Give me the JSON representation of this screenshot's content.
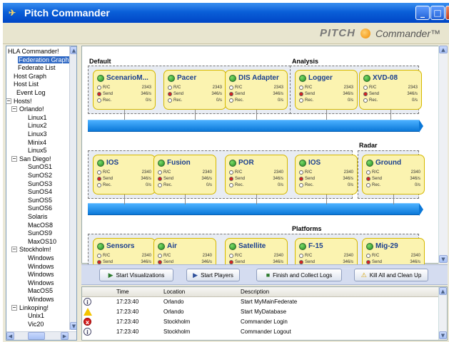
{
  "window": {
    "title": "Pitch Commander"
  },
  "brand": {
    "pitch": "PITCH",
    "product": "Commander™"
  },
  "tree": [
    {
      "label": "HLA Commander!"
    },
    {
      "label": "Federation Graph",
      "selected": true
    },
    {
      "label": "Federate List"
    },
    {
      "label": "Host Graph"
    },
    {
      "label": "Host List"
    },
    {
      "label": "Event Log"
    },
    {
      "label": "Hosts!"
    },
    {
      "label": "Orlando!"
    },
    {
      "label": "Linux1"
    },
    {
      "label": "Linux2"
    },
    {
      "label": "Linux3"
    },
    {
      "label": "Minix4"
    },
    {
      "label": "Linux5"
    },
    {
      "label": "San Diego!"
    },
    {
      "label": "SunOS1"
    },
    {
      "label": "SunOS2"
    },
    {
      "label": "SunOS3"
    },
    {
      "label": "SunOS4"
    },
    {
      "label": "SunOS5"
    },
    {
      "label": "SunOS6"
    },
    {
      "label": "Solaris"
    },
    {
      "label": "MacOS8"
    },
    {
      "label": "SunOS9"
    },
    {
      "label": "MaxOS10"
    },
    {
      "label": "Stockholm!"
    },
    {
      "label": "Windows"
    },
    {
      "label": "Windows"
    },
    {
      "label": "Windows"
    },
    {
      "label": "Windows"
    },
    {
      "label": "MacOS5"
    },
    {
      "label": "Windows"
    },
    {
      "label": "Linkoping!"
    },
    {
      "label": "Unix1"
    },
    {
      "label": "Vic20"
    }
  ],
  "groups": [
    "Default",
    "Analysis",
    "Radar",
    "Platforms"
  ],
  "row_labels": {
    "r1": "R/C",
    "r2": "Send",
    "r3": "Rec."
  },
  "federates": [
    {
      "name": "ScenarioM...",
      "rc": "2343",
      "send": "346/s",
      "rec": "0/s",
      "status": "#2e9a2e"
    },
    {
      "name": "Pacer",
      "rc": "2343",
      "send": "346/s",
      "rec": "0/s",
      "status": "#2e9a2e"
    },
    {
      "name": "DIS Adapter",
      "rc": "2343",
      "send": "346/s",
      "rec": "0/s",
      "status": "#2e9a2e"
    },
    {
      "name": "Logger",
      "rc": "2343",
      "send": "346/s",
      "rec": "0/s",
      "status": "#2e9a2e"
    },
    {
      "name": "XVD-08",
      "rc": "2343",
      "send": "346/s",
      "rec": "0/s",
      "status": "#2e9a2e"
    },
    {
      "name": "IOS",
      "rc": "2340",
      "send": "346/s",
      "rec": "0/s",
      "status": "#2e9a2e"
    },
    {
      "name": "Fusion",
      "rc": "2340",
      "send": "346/s",
      "rec": "0/s",
      "status": "#2e9a2e"
    },
    {
      "name": "POR",
      "rc": "2340",
      "send": "346/s",
      "rec": "0/s",
      "status": "#2e9a2e"
    },
    {
      "name": "IOS",
      "rc": "2340",
      "send": "346/s",
      "rec": "0/s",
      "status": "#2e9a2e"
    },
    {
      "name": "Ground",
      "rc": "2340",
      "send": "346/s",
      "rec": "0/s",
      "status": "#2e9a2e"
    },
    {
      "name": "Sensors",
      "rc": "2340",
      "send": "346/s",
      "rec": "",
      "status": "#2e9a2e"
    },
    {
      "name": "Air",
      "rc": "2340",
      "send": "346/s",
      "rec": "",
      "status": "#2e9a2e"
    },
    {
      "name": "Satellite",
      "rc": "2340",
      "send": "346/s",
      "rec": "",
      "status": "#2e9a2e"
    },
    {
      "name": "F-15",
      "rc": "2340",
      "send": "346/s",
      "rec": "",
      "status": "#2e9a2e"
    },
    {
      "name": "Mig-29",
      "rc": "2340",
      "send": "346/s",
      "rec": "",
      "status": "#2e9a2e"
    }
  ],
  "actions": {
    "start_vis": "Start Visualizations",
    "start_players": "Start Players",
    "finish": "Finish and Collect Logs",
    "kill": "Kill All and Clean Up"
  },
  "log": {
    "headers": {
      "time": "Time",
      "location": "Location",
      "description": "Description"
    },
    "rows": [
      {
        "icon": "info",
        "time": "17:23:40",
        "location": "Orlando",
        "description": "Start MyMainFederate"
      },
      {
        "icon": "warning",
        "time": "17:23:40",
        "location": "Orlando",
        "description": "Start MyDatabase"
      },
      {
        "icon": "error",
        "time": "17:23:40",
        "location": "Stockholm",
        "description": "Commander Login"
      },
      {
        "icon": "info",
        "time": "17:23:40",
        "location": "Stockholm",
        "description": "Commander Logout"
      }
    ]
  },
  "colors": {
    "titlebar": "#0a5fd8",
    "bus": "#0b78d8",
    "federate_bg": "#fbf3b0",
    "federate_border": "#d5b800",
    "selected": "#316ac5"
  }
}
